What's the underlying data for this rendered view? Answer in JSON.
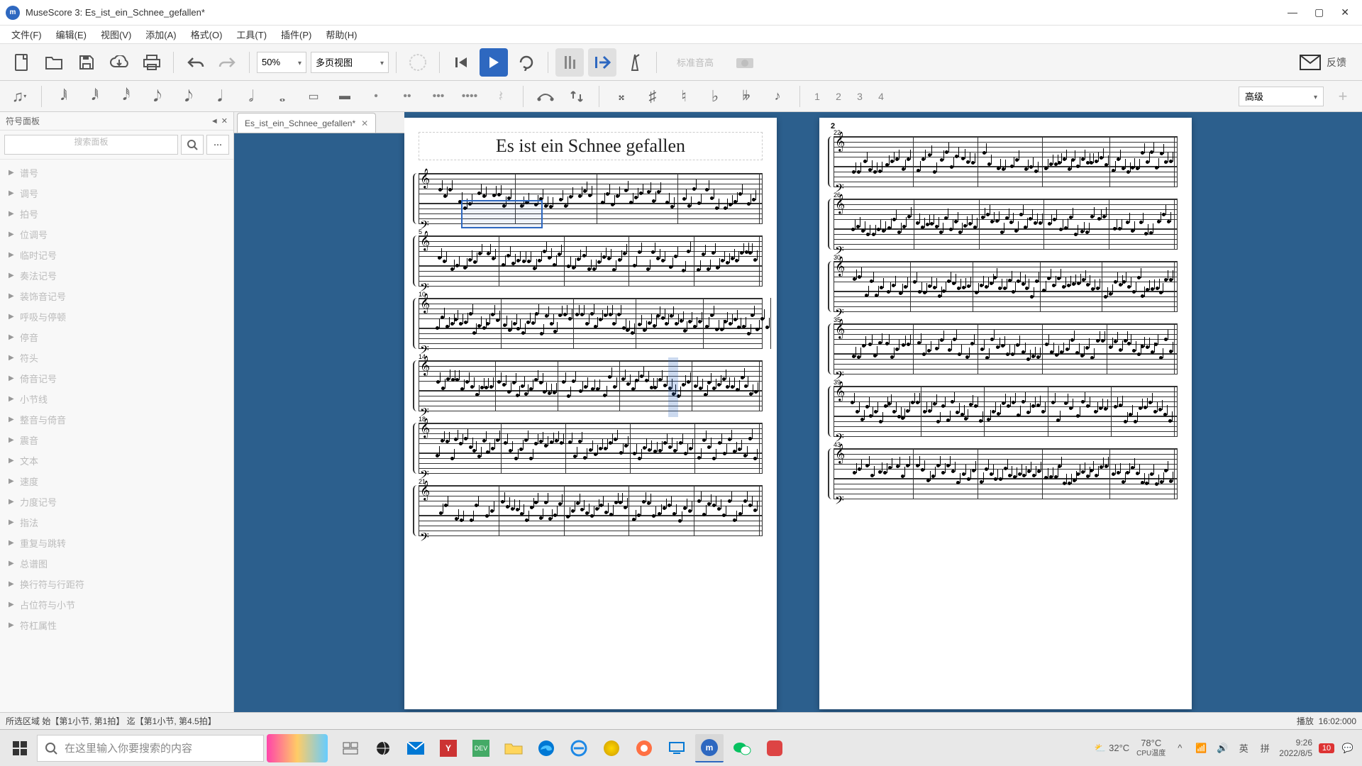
{
  "window": {
    "app_logo_letter": "m",
    "title": "MuseScore 3: Es_ist_ein_Schnee_gefallen*",
    "min_icon": "minimize-icon",
    "max_icon": "maximize-icon",
    "close_icon": "close-icon"
  },
  "menu": {
    "items": [
      "文件(F)",
      "编辑(E)",
      "视图(V)",
      "添加(A)",
      "格式(O)",
      "工具(T)",
      "插件(P)",
      "帮助(H)"
    ]
  },
  "toolbar": {
    "zoom_value": "50%",
    "view_mode": "多页视图",
    "pitch_label": "标准音高",
    "feedback_label": "反馈",
    "icons": {
      "new": "new-file-icon",
      "open": "open-folder-icon",
      "save": "save-icon",
      "cloud": "cloud-icon",
      "print": "print-icon",
      "undo": "undo-icon",
      "redo": "redo-icon",
      "metronome": "metronome-icon",
      "rewind": "rewind-start-icon",
      "play": "play-icon",
      "loop": "loop-icon",
      "countin": "count-in-icon",
      "pan": "pan-icon",
      "midi": "midi-input-icon",
      "camera": "screenshot-icon",
      "mail": "feedback-mail-icon"
    }
  },
  "note_toolbar": {
    "voices": [
      "1",
      "2",
      "3",
      "4"
    ],
    "workspace": "高级",
    "icons": {
      "note_input": "note-input-icon",
      "d64": "64th-note-icon",
      "d32": "32nd-note-icon",
      "d16": "16th-note-icon",
      "d8": "8th-note-icon",
      "d4": "quarter-note-icon",
      "d2": "half-note-icon",
      "d1": "whole-note-icon",
      "d1b": "breve-note-icon",
      "dot1": "dot-icon",
      "dot2": "double-dot-icon",
      "dot3": "triple-dot-icon",
      "dot4": "quad-dot-icon",
      "rest": "rest-icon",
      "tie": "tie-icon",
      "flip": "flip-direction-icon",
      "dsharp": "double-sharp-icon",
      "sharp": "sharp-icon",
      "natural": "natural-icon",
      "flat": "flat-icon",
      "dflat": "double-flat-icon",
      "grace": "grace-note-icon"
    }
  },
  "palette": {
    "title": "符号面板",
    "search_placeholder": "搜索面板",
    "items": [
      "谱号",
      "调号",
      "拍号",
      "位调号",
      "临时记号",
      "奏法记号",
      "装饰音记号",
      "呼吸与停顿",
      "停音",
      "符头",
      "倚音记号",
      "小节线",
      "整音与倚音",
      "震音",
      "文本",
      "速度",
      "力度记号",
      "指法",
      "重复与跳转",
      "总谱图",
      "换行符与行距符",
      "占位符与小节",
      "符杠属性"
    ]
  },
  "document": {
    "tab_label": "Es_ist_ein_Schnee_gefallen*",
    "score_title": "Es ist ein Schnee gefallen",
    "page2_number": "2",
    "measure_numbers_p1": [
      "",
      "5",
      "10",
      "14",
      "18",
      "21"
    ],
    "measure_numbers_p2": [
      "22",
      "26",
      "30",
      "35",
      "39",
      "43"
    ]
  },
  "status": {
    "selection": "所选区域 始【第1小节, 第1拍】 迄【第1小节, 第4.5拍】",
    "playback_label": "播放",
    "playback_time": "16:02:000"
  },
  "taskbar": {
    "search_placeholder": "在这里输入你要搜索的内容",
    "weather_temp": "32°C",
    "cpu_temp": "78°C",
    "cpu_label": "CPU温度",
    "ime_lang": "英",
    "ime_mode": "拼",
    "time": "9:26",
    "date": "2022/8/5",
    "notif_count": "10"
  }
}
